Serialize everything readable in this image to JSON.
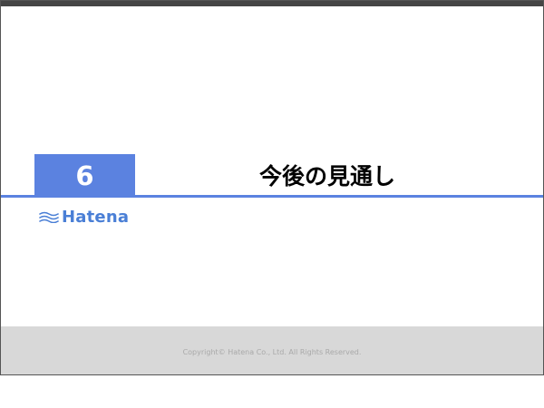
{
  "slide": {
    "section_number": "6",
    "section_title": "今後の見通し",
    "logo_text": "Hatena",
    "copyright": "Copyright©  Hatena Co., Ltd.   All Rights Reserved."
  },
  "colors": {
    "accent": "#5b82e0",
    "logo": "#4a7fd6",
    "top_bar": "#454545",
    "footer": "#d8d8d8"
  },
  "icons": {
    "logo_mark": "hatena-logo-icon"
  }
}
